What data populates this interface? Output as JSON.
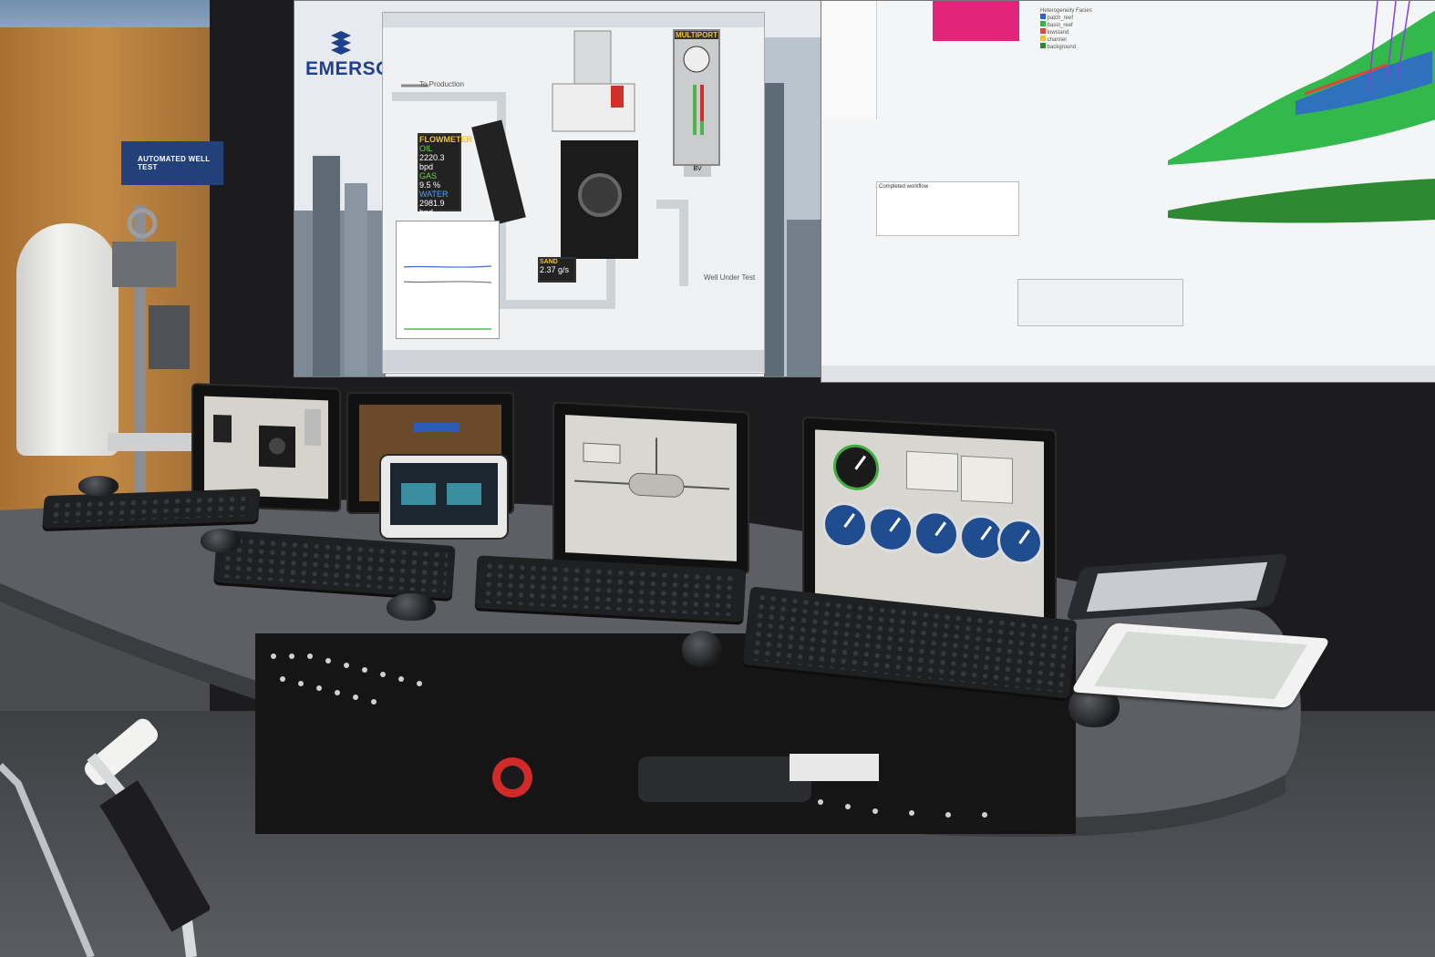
{
  "booth": {
    "banner_text": "AUTOMATED WELL TEST"
  },
  "video_wall": {
    "brand": "EMERSON",
    "hmi": {
      "to_production": "To Production",
      "well_under_test": "Well Under Test",
      "flowmeter": {
        "title": "FLOWMETER",
        "oil_label": "OIL",
        "oil_value": "2220.3",
        "oil_unit": "bpd",
        "gas_label": "GAS",
        "gas_value": "9.5",
        "gas_unit": "%",
        "water_label": "WATER",
        "water_value": "2981.9",
        "water_unit": "bpd"
      },
      "sand": {
        "label": "SAND",
        "value": "2.37",
        "unit": "g/s"
      },
      "multiport": {
        "title": "MULTIPORT",
        "button": "BV"
      }
    },
    "right_panel": {
      "legend_title": "Heterogeneity Facies",
      "legend_items": [
        {
          "label": "patch_reef",
          "color": "#2e5fd9"
        },
        {
          "label": "basin_reef",
          "color": "#38b248"
        },
        {
          "label": "lowstand",
          "color": "#e0453c"
        },
        {
          "label": "channel",
          "color": "#f1c232"
        },
        {
          "label": "background",
          "color": "#2d8a32"
        }
      ],
      "workflow_status": "Completed workflow"
    }
  },
  "colors": {
    "wall_black": "#1c1c1e",
    "desk_grey": "#5d5f64",
    "brand_blue": "#1f3f8f",
    "gauge_blue": "#1f4d8f",
    "model_green": "#33b94b"
  }
}
